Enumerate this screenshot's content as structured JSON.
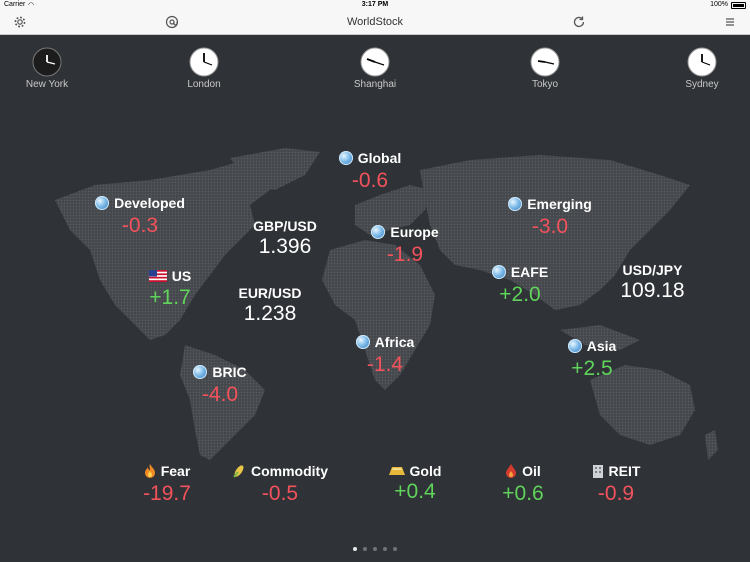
{
  "status": {
    "carrier": "Carrier",
    "time": "3:17 PM",
    "battery": "100%"
  },
  "nav": {
    "title": "WorldStock",
    "settings_icon": "gear-icon",
    "at_icon": "at-icon",
    "refresh_icon": "refresh-icon",
    "menu_icon": "menu-icon"
  },
  "clocks": [
    {
      "label": "New York",
      "time": "03:17",
      "style": "dark"
    },
    {
      "label": "London",
      "time": "20:17",
      "style": "light"
    },
    {
      "label": "Shanghai",
      "time": "03:17",
      "style": "light"
    },
    {
      "label": "Tokyo",
      "time": "04:17",
      "style": "light"
    },
    {
      "label": "Sydney",
      "time": "06:17",
      "style": "light"
    }
  ],
  "markets": {
    "global": {
      "name": "Global",
      "value": "-0.6"
    },
    "developed": {
      "name": "Developed",
      "value": "-0.3"
    },
    "emerging": {
      "name": "Emerging",
      "value": "-3.0"
    },
    "gbpusd": {
      "name": "GBP/USD",
      "value": "1.396"
    },
    "europe": {
      "name": "Europe",
      "value": "-1.9"
    },
    "us": {
      "name": "US",
      "value": "+1.7"
    },
    "eafe": {
      "name": "EAFE",
      "value": "+2.0"
    },
    "usdjpy": {
      "name": "USD/JPY",
      "value": "109.18"
    },
    "eurusd": {
      "name": "EUR/USD",
      "value": "1.238"
    },
    "africa": {
      "name": "Africa",
      "value": "-1.4"
    },
    "asia": {
      "name": "Asia",
      "value": "+2.5"
    },
    "bric": {
      "name": "BRIC",
      "value": "-4.0"
    }
  },
  "indicators": {
    "fear": {
      "name": "Fear",
      "value": "-19.7"
    },
    "commodity": {
      "name": "Commodity",
      "value": "-0.5"
    },
    "gold": {
      "name": "Gold",
      "value": "+0.4"
    },
    "oil": {
      "name": "Oil",
      "value": "+0.6"
    },
    "reit": {
      "name": "REIT",
      "value": "-0.9"
    }
  },
  "pager": {
    "pages": 5,
    "active": 1
  },
  "colors": {
    "negative": "#f2525c",
    "positive": "#5fd35a",
    "background": "#2f3236",
    "map": "#4a4d51"
  }
}
